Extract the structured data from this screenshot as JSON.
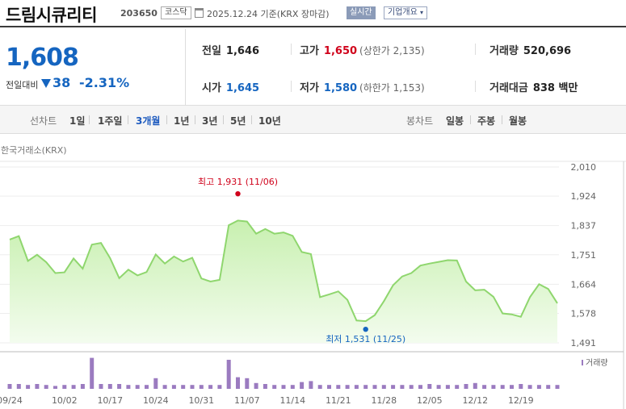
{
  "header": {
    "company": "드림시큐리티",
    "code": "203650",
    "market": "코스닥",
    "date": "2025.12.24 기준(KRX 장마감)",
    "realtime": "실시간",
    "company_info": "기업개요"
  },
  "price": {
    "current": "1,608",
    "change_label": "전일대비",
    "change": "38",
    "change_pct": "-2.31%"
  },
  "stats": {
    "prev_label": "전일",
    "prev": "1,646",
    "high_label": "고가",
    "high": "1,650",
    "upper_label": "(상한가 2,135)",
    "volume_label": "거래량",
    "volume": "520,696",
    "open_label": "시가",
    "open": "1,645",
    "low_label": "저가",
    "low": "1,580",
    "lower_label": "(하한가 1,153)",
    "amount_label": "거래대금",
    "amount": "838 백만"
  },
  "period_bar": {
    "line_chart_label": "선차트",
    "line_periods": [
      "1일",
      "1주일",
      "3개월",
      "1년",
      "3년",
      "5년",
      "10년"
    ],
    "active": "3개월",
    "candle_label": "봉차트",
    "candle_periods": [
      "일봉",
      "주봉",
      "월봉"
    ]
  },
  "source": "한국거래소(KRX)",
  "colors": {
    "down": "#1565c0",
    "up": "#d0021b",
    "line": "#8fd66e",
    "volume": "#9b7bc0"
  },
  "chart_data": {
    "type": "area",
    "ylim": [
      1491,
      2010
    ],
    "yticks": [
      "2,010",
      "1,924",
      "1,837",
      "1,751",
      "1,664",
      "1,578",
      "1,491"
    ],
    "ytick_values": [
      2010,
      1924,
      1837,
      1751,
      1664,
      1578,
      1491
    ],
    "xlabels": [
      "09/24",
      "10/02",
      "10/17",
      "10/24",
      "10/31",
      "11/07",
      "11/14",
      "11/21",
      "11/28",
      "12/05",
      "12/12",
      "12/19"
    ],
    "xlabel_index": [
      0,
      6,
      11,
      16,
      21,
      26,
      31,
      36,
      41,
      46,
      51,
      56
    ],
    "values": [
      1796,
      1806,
      1733,
      1751,
      1729,
      1697,
      1699,
      1740,
      1710,
      1781,
      1786,
      1741,
      1682,
      1707,
      1690,
      1700,
      1752,
      1725,
      1746,
      1731,
      1742,
      1681,
      1672,
      1677,
      1838,
      1852,
      1849,
      1813,
      1827,
      1813,
      1817,
      1807,
      1759,
      1753,
      1626,
      1634,
      1643,
      1618,
      1557,
      1555,
      1573,
      1614,
      1661,
      1687,
      1697,
      1719,
      1725,
      1730,
      1735,
      1734,
      1672,
      1646,
      1648,
      1627,
      1578,
      1575,
      1568,
      1626,
      1664,
      1650,
      1608
    ],
    "volume_legend": "거래량",
    "volume": [
      5,
      5,
      4,
      5,
      4,
      3,
      4,
      4,
      5,
      32,
      5,
      5,
      5,
      4,
      4,
      4,
      11,
      4,
      4,
      4,
      4,
      4,
      4,
      4,
      30,
      12,
      11,
      6,
      5,
      4,
      4,
      4,
      7,
      8,
      4,
      4,
      4,
      4,
      4,
      4,
      4,
      4,
      4,
      4,
      4,
      4,
      5,
      4,
      4,
      4,
      5,
      6,
      4,
      4,
      4,
      4,
      5,
      4,
      4,
      4,
      4
    ],
    "annotations": [
      {
        "label": "최고 1,931 (11/06)",
        "value": 1931,
        "index": 25,
        "color": "#d0021b"
      },
      {
        "label": "최저 1,531 (11/25)",
        "value": 1531,
        "index": 39,
        "color": "#1565c0"
      }
    ]
  }
}
